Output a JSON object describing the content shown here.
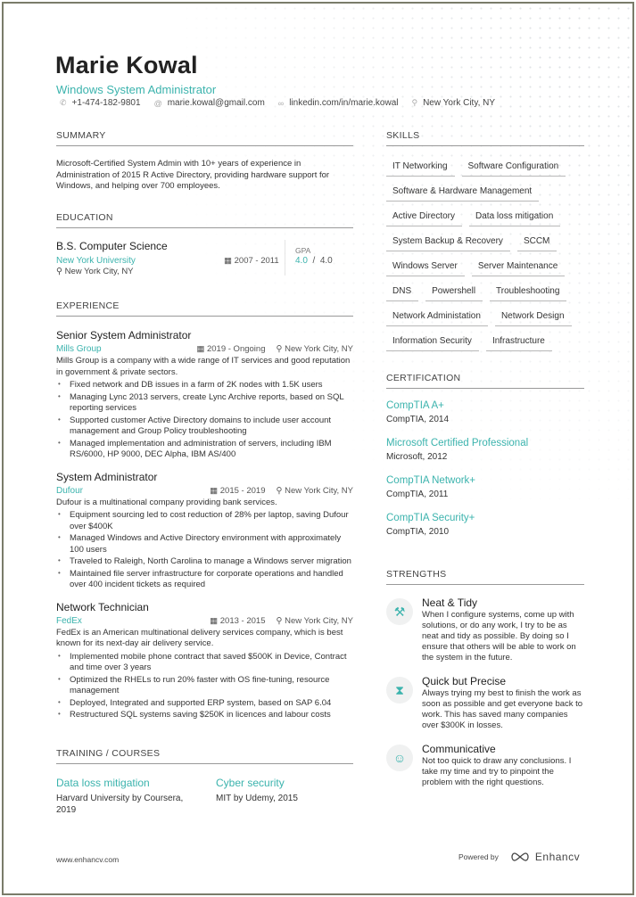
{
  "header": {
    "name": "Marie Kowal",
    "title": "Windows System Administrator",
    "contacts": [
      {
        "icon": "phone-icon",
        "glyph": "✆",
        "text": "+1-474-182-9801"
      },
      {
        "icon": "at-icon",
        "glyph": "@",
        "text": "marie.kowal@gmail.com"
      },
      {
        "icon": "link-icon",
        "glyph": "∞",
        "text": "linkedin.com/in/marie.kowal"
      },
      {
        "icon": "location-icon",
        "glyph": "⚲",
        "text": "New York City, NY"
      }
    ]
  },
  "summary": {
    "heading": "SUMMARY",
    "text": "Microsoft-Certified System Admin with 10+ years of experience in Administration of 2015 R Active Directory, providing hardware support for Windows, and helping over 700 employees."
  },
  "education": {
    "heading": "EDUCATION",
    "degree": "B.S. Computer Science",
    "school": "New York University",
    "location": "New York City, NY",
    "dates": "2007 - 2011",
    "gpa_label": "GPA",
    "gpa_value": "4.0",
    "gpa_sep": "/",
    "gpa_max": "4.0"
  },
  "experience": {
    "heading": "EXPERIENCE",
    "jobs": [
      {
        "title": "Senior System Administrator",
        "company": "Mills Group",
        "dates": "2019 - Ongoing",
        "location": "New York City, NY",
        "description": "Mills Group is a company with a wide range of IT services and good reputation in government & private sectors.",
        "bullets": [
          "Fixed network and DB issues in a farm of 2K nodes with 1.5K users",
          "Managing Lync 2013 servers, create Lync Archive reports, based on SQL reporting services",
          "Supported customer Active Directory domains to include user account management and Group Policy troubleshooting",
          "Managed implementation and administration of servers, including IBM RS/6000, HP 9000, DEC Alpha, IBM AS/400"
        ]
      },
      {
        "title": "System Administrator",
        "company": "Dufour",
        "dates": "2015 - 2019",
        "location": "New York City, NY",
        "description": "Dufour is a multinational company providing bank services.",
        "bullets": [
          "Equipment sourcing led to cost reduction of 28% per laptop, saving Dufour over $400K",
          "Managed Windows and Active Directory environment with approximately 100 users",
          "Traveled to Raleigh, North Carolina to manage a Windows server migration",
          "Maintained file server infrastructure for corporate operations and handled over 400 incident tickets as required"
        ]
      },
      {
        "title": "Network Technician",
        "company": "FedEx",
        "dates": "2013 - 2015",
        "location": "New York City, NY",
        "description": "FedEx is an American multinational delivery services company, which is best known for its next-day air delivery service.",
        "bullets": [
          "Implemented mobile phone contract that saved $500K in Device, Contract and time over 3 years",
          "Optimized the RHELs to run 20% faster with OS fine-tuning, resource management",
          "Deployed, Integrated and supported ERP system, based on SAP 6.04",
          "Restructured SQL systems saving $250K in licences and labour costs"
        ]
      }
    ]
  },
  "training": {
    "heading": "TRAINING / COURSES",
    "items": [
      {
        "title": "Data loss mitigation",
        "subtitle": "Harvard University by Coursera, 2019"
      },
      {
        "title": "Cyber security",
        "subtitle": "MIT by Udemy, 2015"
      }
    ]
  },
  "skills": {
    "heading": "SKILLS",
    "items": [
      "IT Networking",
      "Software Configuration",
      "Software & Hardware Management",
      "Active Directory",
      "Data loss mitigation",
      "System Backup & Recovery",
      "SCCM",
      "Windows Server",
      "Server Maintenance",
      "DNS",
      "Powershell",
      "Troubleshooting",
      "Network Administation",
      "Network Design",
      "Information Security",
      "Infrastructure"
    ]
  },
  "certification": {
    "heading": "CERTIFICATION",
    "items": [
      {
        "title": "CompTIA A+",
        "subtitle": "CompTIA, 2014"
      },
      {
        "title": "Microsoft Certified Professional",
        "subtitle": "Microsoft, 2012"
      },
      {
        "title": "CompTIA Network+",
        "subtitle": "CompTIA, 2011"
      },
      {
        "title": "CompTIA Security+",
        "subtitle": "CompTIA, 2010"
      }
    ]
  },
  "strengths": {
    "heading": "STRENGTHS",
    "items": [
      {
        "icon": "tools-icon",
        "glyph": "⚒",
        "title": "Neat & Tidy",
        "text": "When I configure systems, come up with solutions, or do any work, I try to be as neat and tidy as possible. By doing so I ensure that others will be able to work on the system in the future."
      },
      {
        "icon": "hourglass-icon",
        "glyph": "⧗",
        "title": "Quick but Precise",
        "text": "Always trying my best to finish the work as soon as possible and get everyone back to work. This has saved many companies over $300K in losses."
      },
      {
        "icon": "speech-icon",
        "glyph": "☺",
        "title": "Communicative",
        "text": "Not too quick to draw any conclusions. I take my time and try to pinpoint the problem with the right questions."
      }
    ]
  },
  "footer": {
    "website": "www.enhancv.com",
    "powered_by": "Powered by",
    "brand": "Enhancv"
  },
  "colors": {
    "accent": "#3bb3ad",
    "text": "#333333",
    "border": "#7a7c6a"
  }
}
